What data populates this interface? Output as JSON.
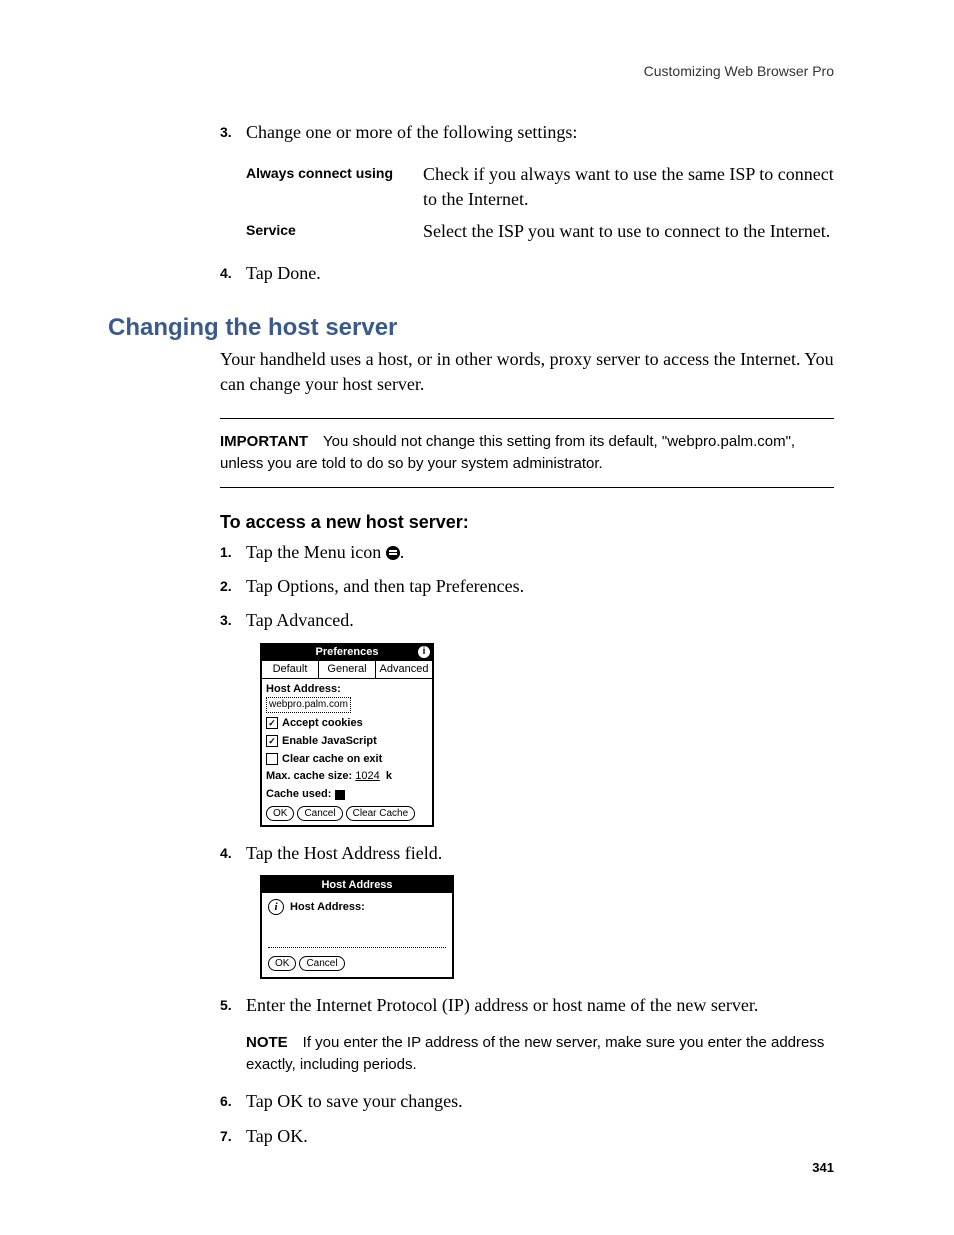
{
  "header": {
    "running": "Customizing Web Browser Pro"
  },
  "top_list": {
    "item3_num": "3.",
    "item3_text": "Change one or more of the following settings:",
    "settings": [
      {
        "term": "Always connect using",
        "def": "Check if you always want to use the same ISP to connect to the Internet."
      },
      {
        "term": "Service",
        "def": "Select the ISP you want to use to connect to the Internet."
      }
    ],
    "item4_num": "4.",
    "item4_text": "Tap Done."
  },
  "h2": "Changing the host server",
  "intro": "Your handheld uses a host, or in other words, proxy server to access the Internet. You can change your host server.",
  "important": {
    "lead": "IMPORTANT",
    "text": "You should not change this setting from its default, \"webpro.palm.com\", unless you are told to do so by your system administrator."
  },
  "subhead": "To access a new host server:",
  "steps": {
    "s1_num": "1.",
    "s1_a": "Tap the Menu icon ",
    "s1_b": ".",
    "s2_num": "2.",
    "s2": "Tap Options, and then tap Preferences.",
    "s3_num": "3.",
    "s3": "Tap Advanced.",
    "s4_num": "4.",
    "s4": "Tap the Host Address field.",
    "s5_num": "5.",
    "s5": "Enter the Internet Protocol (IP) address or host name of the new server.",
    "s6_num": "6.",
    "s6": "Tap OK to save your changes.",
    "s7_num": "7.",
    "s7": "Tap OK."
  },
  "note": {
    "lead": "NOTE",
    "text": "If you enter the IP address of the new server, make sure you enter the address exactly, including periods."
  },
  "pref_dialog": {
    "title": "Preferences",
    "tabs": [
      "Default",
      "General",
      "Advanced"
    ],
    "host_label": "Host Address:",
    "host_value": "webpro.palm.com",
    "chk_cookies": "Accept cookies",
    "chk_js": "Enable JavaScript",
    "chk_clear": "Clear cache on exit",
    "max_cache_label": "Max. cache size:",
    "max_cache_value": "1024",
    "max_cache_unit": "k",
    "cache_used_label": "Cache used:",
    "buttons": [
      "OK",
      "Cancel",
      "Clear Cache"
    ]
  },
  "host_dialog": {
    "title": "Host Address",
    "label": "Host Address:",
    "buttons": [
      "OK",
      "Cancel"
    ]
  },
  "page_number": "341"
}
